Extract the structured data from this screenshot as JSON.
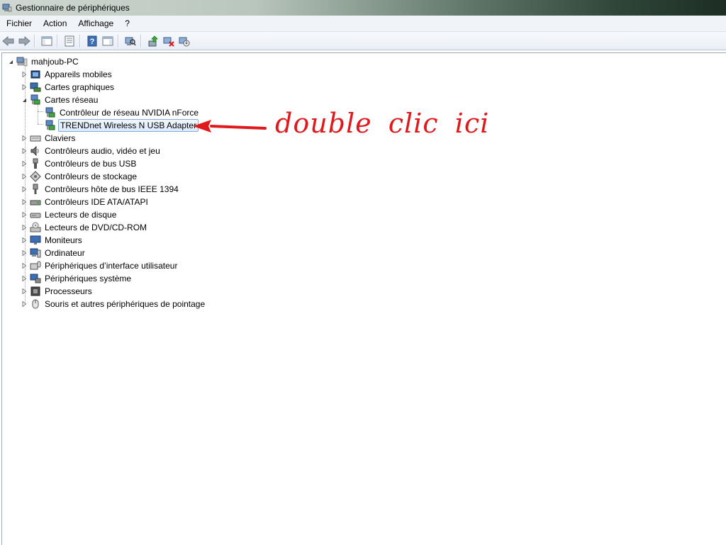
{
  "window": {
    "title": "Gestionnaire de périphériques"
  },
  "menu": {
    "items": [
      "Fichier",
      "Action",
      "Affichage",
      "?"
    ]
  },
  "toolbar": {
    "buttons": [
      "back-arrow-icon",
      "forward-arrow-icon",
      "show-hide-console-tree-icon",
      "properties-icon",
      "help-icon",
      "action-pane-icon",
      "scan-hardware-icon",
      "update-driver-icon",
      "uninstall-icon",
      "disable-icon"
    ]
  },
  "tree": {
    "root": "mahjoub-PC",
    "categories": [
      {
        "label": "Appareils mobiles",
        "expanded": false
      },
      {
        "label": "Cartes graphiques",
        "expanded": false
      },
      {
        "label": "Cartes réseau",
        "expanded": true,
        "children": [
          "Contrôleur de réseau NVIDIA nForce",
          "TRENDnet Wireless N USB Adapter"
        ]
      },
      {
        "label": "Claviers",
        "expanded": false
      },
      {
        "label": "Contrôleurs audio, vidéo et jeu",
        "expanded": false
      },
      {
        "label": "Contrôleurs de bus USB",
        "expanded": false
      },
      {
        "label": "Contrôleurs de stockage",
        "expanded": false
      },
      {
        "label": "Contrôleurs hôte de bus IEEE 1394",
        "expanded": false
      },
      {
        "label": "Contrôleurs IDE ATA/ATAPI",
        "expanded": false
      },
      {
        "label": "Lecteurs de disque",
        "expanded": false
      },
      {
        "label": "Lecteurs de DVD/CD-ROM",
        "expanded": false
      },
      {
        "label": "Moniteurs",
        "expanded": false
      },
      {
        "label": "Ordinateur",
        "expanded": false
      },
      {
        "label": "Périphériques d’interface utilisateur",
        "expanded": false
      },
      {
        "label": "Périphériques système",
        "expanded": false
      },
      {
        "label": "Processeurs",
        "expanded": false
      },
      {
        "label": "Souris et autres périphériques de pointage",
        "expanded": false
      }
    ],
    "selected": "TRENDnet Wireless N USB Adapter"
  },
  "annotation": {
    "text": "double clic ici",
    "color": "#e0191d"
  },
  "colors": {
    "selection_border": "#84acdd",
    "selection_fill": "#dbeafc",
    "menubar": "#f0f3f8"
  }
}
